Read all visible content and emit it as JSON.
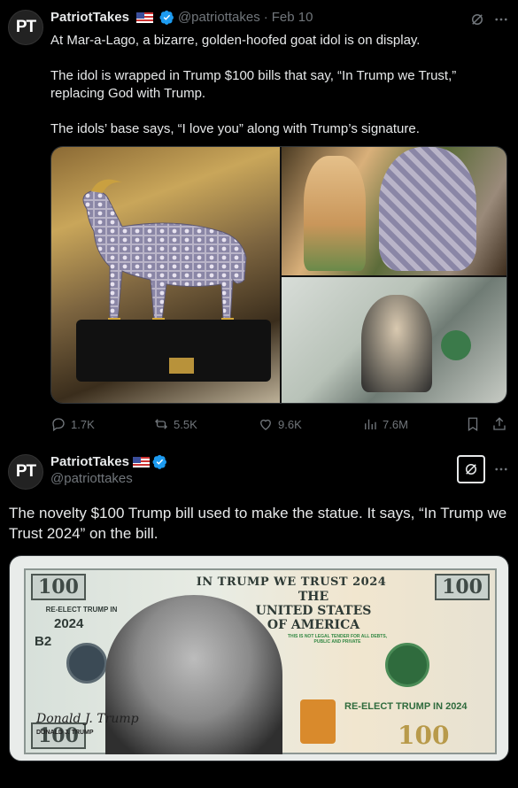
{
  "tweet1": {
    "avatar_text": "PT",
    "display_name": "PatriotTakes",
    "handle": "@patriottakes",
    "separator": "·",
    "date": "Feb 10",
    "paragraphs": [
      "At Mar-a-Lago, a bizarre, golden-hoofed goat idol is on display.",
      "The idol is wrapped in Trump $100 bills that say, “In Trump we Trust,” replacing God with Trump.",
      "The idols’ base says, “I love you” along with Trump’s signature."
    ],
    "stats": {
      "replies": "1.7K",
      "reposts": "5.5K",
      "likes": "9.6K",
      "views": "7.6M"
    }
  },
  "tweet2": {
    "avatar_text": "PT",
    "display_name": "PatriotTakes",
    "handle": "@patriottakes",
    "text": "The novelty $100 Trump bill used to make the statue. It says, “In Trump we Trust 2024” on the bill.",
    "bill": {
      "corner_value": "100",
      "banner": "IN TRUMP WE TRUST 2024",
      "states_line1": "THE",
      "states_line2": "UNITED STATES",
      "states_line3": "OF AMERICA",
      "reelect_small": "RE-ELECT TRUMP IN",
      "year": "2024",
      "series_code": "B2",
      "legal_text": "THIS IS NOT LEGAL TENDER FOR ALL DEBTS, PUBLIC AND PRIVATE",
      "reelect_big": "RE-ELECT TRUMP IN 2024",
      "signature": "Donald J. Trump",
      "signature_label": "DONALD J. TRUMP"
    }
  },
  "colors": {
    "background": "#000000",
    "text": "#e7e9ea",
    "muted": "#71767b",
    "verified": "#1d9bf0"
  }
}
